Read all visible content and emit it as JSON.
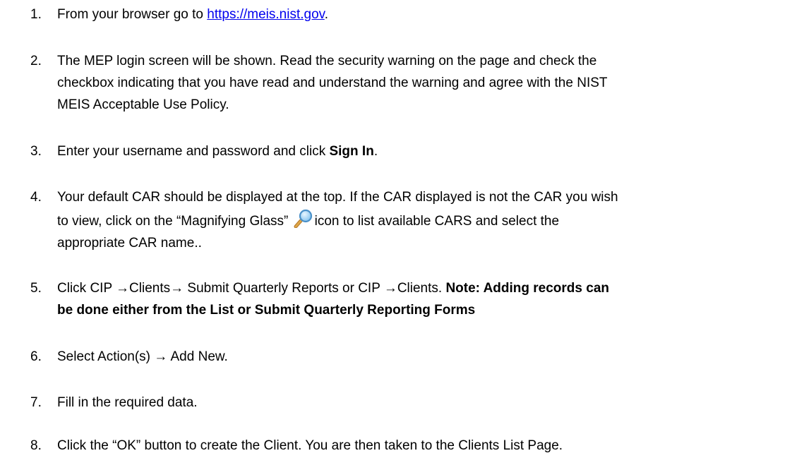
{
  "steps": [
    {
      "n": "1.",
      "pre": "From your browser go to ",
      "link": "https://meis.nist.gov",
      "post": "."
    },
    {
      "n": "2.",
      "line1": "The MEP login screen will be shown. Read the security warning on the page and check the",
      "line2": "checkbox indicating that you have read and understand the warning and agree with the NIST",
      "line3": "MEIS Acceptable Use Policy."
    },
    {
      "n": "3.",
      "pre": "Enter your username and password and click ",
      "bold": "Sign In",
      "post": "."
    },
    {
      "n": "4.",
      "line1": "Your default CAR should be displayed at the top. If the CAR displayed is not the CAR you wish",
      "line2pre": "to view, click on the “Magnifying Glass” ",
      "line2post": "icon to list available CARS and select the",
      "line3": "appropriate CAR name.."
    },
    {
      "n": "5.",
      "pre": "Click CIP →Clients→ Submit Quarterly Reports or CIP →Clients. ",
      "bold1": "Note: Adding records can",
      "bold2": "be done either from the List or Submit Quarterly Reporting Forms"
    },
    {
      "n": "6.",
      "text": "Select Action(s) → Add New."
    },
    {
      "n": "7.",
      "text": "Fill in the required data."
    },
    {
      "n": "8.",
      "text": "Click the “OK” button to create the Client. You are then taken to the Clients List Page."
    }
  ],
  "icons": {
    "magnifier": "magnifying-glass-icon"
  },
  "colors": {
    "link": "#0000ee",
    "text": "#000000"
  }
}
